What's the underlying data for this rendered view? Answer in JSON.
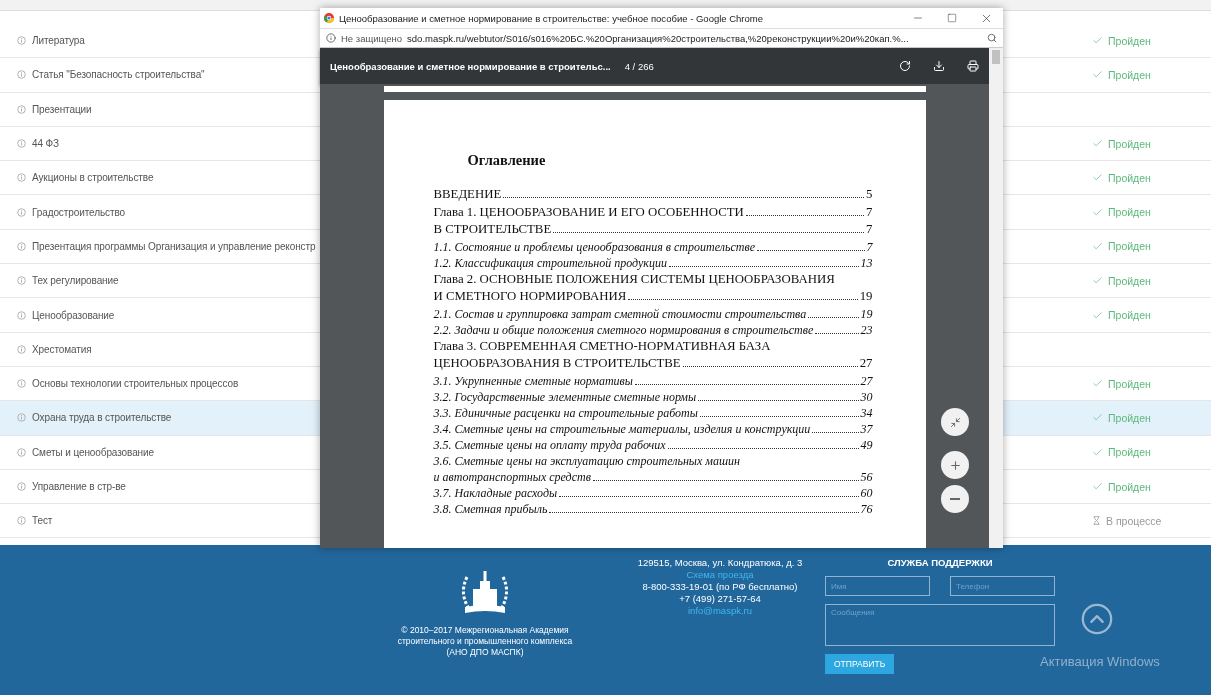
{
  "courses": [
    {
      "title": "Литература",
      "kind": "passed",
      "status": "Пройден",
      "selected": false
    },
    {
      "title": "Статья \"Безопасность строительства\"",
      "kind": "passed",
      "status": "Пройден",
      "selected": false
    },
    {
      "title": "Презентации",
      "kind": "none",
      "selected": false
    },
    {
      "title": "44 ФЗ",
      "kind": "passed",
      "status": "Пройден",
      "selected": false
    },
    {
      "title": "Аукционы в строительстве",
      "kind": "passed",
      "status": "Пройден",
      "selected": false
    },
    {
      "title": "Градостроительство",
      "kind": "passed",
      "status": "Пройден",
      "selected": false
    },
    {
      "title": "Презентация программы Организация и управление реконстр",
      "kind": "passed",
      "status": "Пройден",
      "selected": false
    },
    {
      "title": "Тех регулирование",
      "kind": "passed",
      "status": "Пройден",
      "selected": false
    },
    {
      "title": "Ценообразование",
      "kind": "passed",
      "status": "Пройден",
      "selected": false
    },
    {
      "title": "Хрестоматия",
      "kind": "none",
      "selected": false
    },
    {
      "title": "Основы технологии строительных процессов",
      "kind": "passed",
      "status": "Пройден",
      "selected": false
    },
    {
      "title": "Охрана труда в строительстве",
      "kind": "passed",
      "status": "Пройден",
      "selected": true
    },
    {
      "title": "Сметы и ценообразование",
      "kind": "passed",
      "status": "Пройден",
      "selected": false
    },
    {
      "title": "Управление в стр-ве",
      "kind": "passed",
      "status": "Пройден",
      "selected": false
    },
    {
      "title": "Тест",
      "kind": "in_progress",
      "status": "В процессе",
      "selected": false
    }
  ],
  "popup": {
    "title": "Ценообразование и сметное нормирование в строительстве: учебное пособие - Google Chrome",
    "security": "Не защищено",
    "url": "sdo.maspk.ru/webtutor/S016/s016%20БС.%20Организация%20строительства,%20реконструкции%20и%20кап.%...",
    "viewer": {
      "title": "Ценообразование и сметное нормирование в строительс...",
      "page": "4 / 266"
    },
    "document": {
      "heading": "Оглавление",
      "toc": [
        {
          "kind": "chapter",
          "text": "ВВЕДЕНИЕ",
          "page": "5"
        },
        {
          "kind": "chapter",
          "text": "Глава 1. ЦЕНООБРАЗОВАНИЕ И ЕГО ОСОБЕННОСТИ",
          "page": "7"
        },
        {
          "kind": "chapter",
          "text": "В СТРОИТЕЛЬСТВЕ",
          "page": "7"
        },
        {
          "kind": "section",
          "text": "1.1. Состояние и проблемы ценообразования в строительстве",
          "page": "7"
        },
        {
          "kind": "section",
          "text": "1.2. Классификация строительной продукции",
          "page": "13"
        },
        {
          "kind": "chapter",
          "text": "Глава 2. ОСНОВНЫЕ ПОЛОЖЕНИЯ СИСТЕМЫ ЦЕНООБРАЗОВАНИЯ"
        },
        {
          "kind": "chapter",
          "text": "И СМЕТНОГО НОРМИРОВАНИЯ",
          "page": "19"
        },
        {
          "kind": "section",
          "text": "2.1. Состав и группировка затрат сметной стоимости строительства",
          "page": "19"
        },
        {
          "kind": "section",
          "text": "2.2. Задачи и общие положения сметного нормирования в строительстве",
          "page": "23"
        },
        {
          "kind": "chapter",
          "text": "Глава 3. СОВРЕМЕННАЯ СМЕТНО-НОРМАТИВНАЯ БАЗА"
        },
        {
          "kind": "chapter",
          "text": "ЦЕНООБРАЗОВАНИЯ В СТРОИТЕЛЬСТВЕ",
          "page": "27"
        },
        {
          "kind": "section",
          "text": "3.1. Укрупненные сметные нормативы",
          "page": "27"
        },
        {
          "kind": "section",
          "text": "3.2. Государственные элементные сметные нормы",
          "page": "30"
        },
        {
          "kind": "section",
          "text": "3.3. Единичные расценки на строительные работы",
          "page": "34"
        },
        {
          "kind": "section",
          "text": "3.4. Сметные цены на строительные материалы, изделия и конструкции",
          "page": "37"
        },
        {
          "kind": "section",
          "text": "3.5. Сметные цены на оплату труда рабочих",
          "page": "49"
        },
        {
          "kind": "section",
          "text": "3.6. Сметные цены на эксплуатацию строительных машин"
        },
        {
          "kind": "section",
          "text": "и автотранспортных средств",
          "page": "56"
        },
        {
          "kind": "section",
          "text": "3.7. Накладные расходы",
          "page": "60"
        },
        {
          "kind": "section",
          "text": "3.8. Сметная прибыль",
          "page": "76"
        }
      ]
    }
  },
  "footer": {
    "copyright": [
      "© 2010–2017 Межрегиональная Академия",
      "строительного и промышленного комплекса",
      "(АНО ДПО МАСПК)"
    ],
    "address": "129515, Москва, ул. Кондратюка, д. 3",
    "map_link": "Схема проезда",
    "phone_free": "8-800-333-19-01 (по РФ бесплатно)",
    "phone": "+7 (499) 271-57-64",
    "email": "info@maspk.ru",
    "support": {
      "title": "СЛУЖБА ПОДДЕРЖКИ",
      "name_placeholder": "Имя",
      "phone_placeholder": "Телефон",
      "message_placeholder": "Сообщения",
      "submit": "ОТПРАВИТЬ"
    }
  },
  "os_notice": "Активация Windows"
}
